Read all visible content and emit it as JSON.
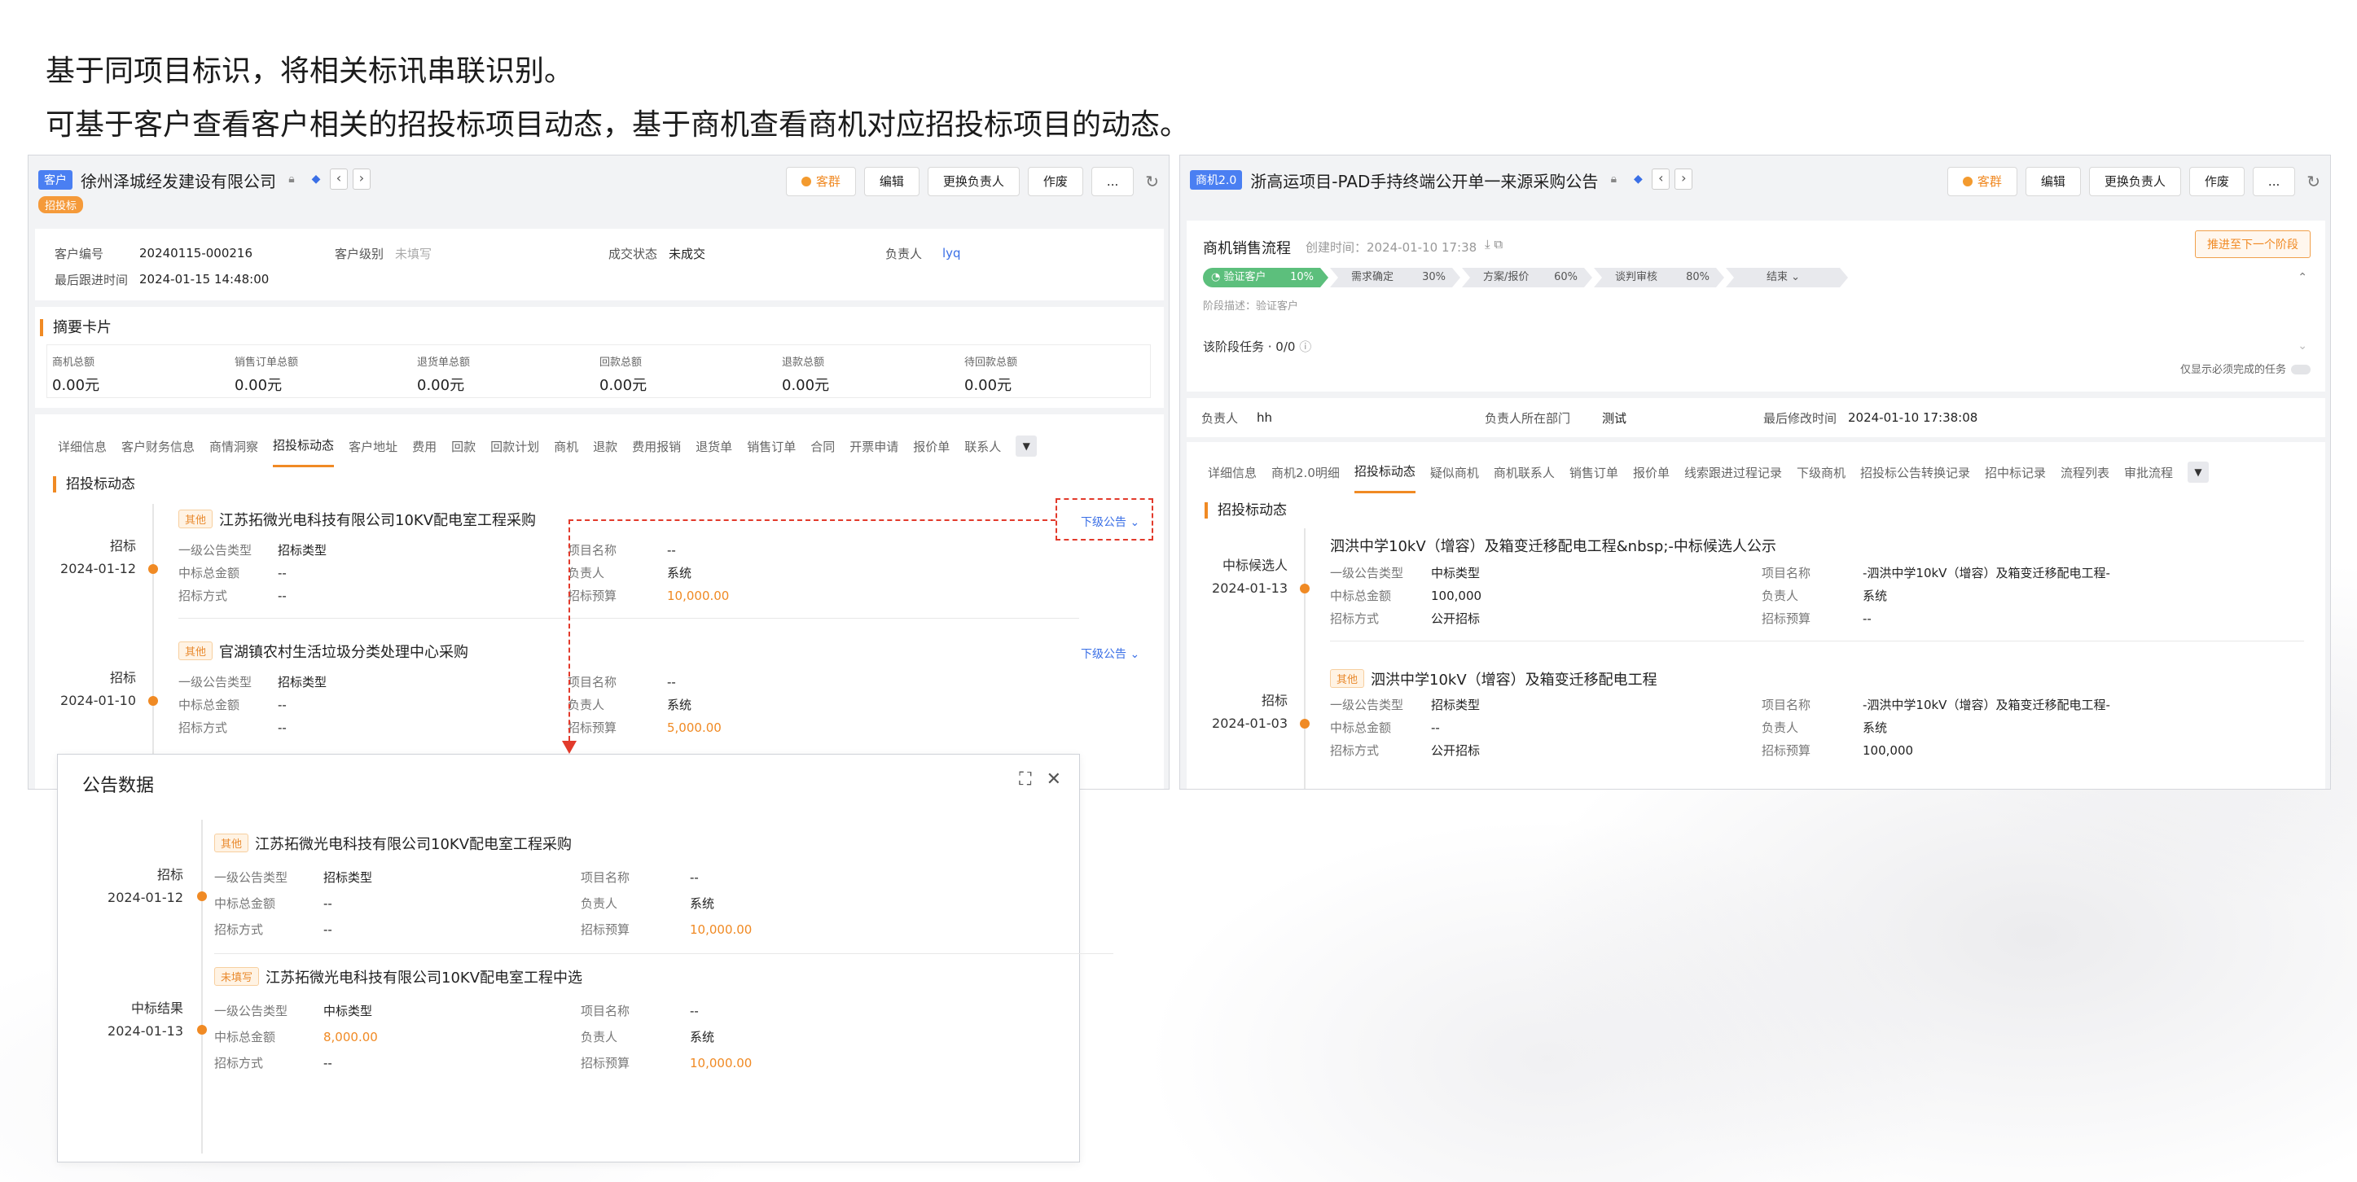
{
  "headline": {
    "line1": "基于同项目标识，将相关标讯串联识别。",
    "line2": "可基于客户查看客户相关的招投标项目动态，基于商机查看商机对应招投标项目的动态。"
  },
  "left": {
    "tag": "客户",
    "title": "徐州泽城经发建设有限公司",
    "sub_tag": "招投标",
    "actions": {
      "group": "客群",
      "edit": "编辑",
      "change_owner": "更换负责人",
      "void": "作废",
      "more": "..."
    },
    "info": {
      "customer_no_label": "客户编号",
      "customer_no": "20240115-000216",
      "level_label": "客户级别",
      "level": "未填写",
      "deal_label": "成交状态",
      "deal": "未成交",
      "owner_label": "负责人",
      "owner": "lyq",
      "last_follow_label": "最后跟进时间",
      "last_follow": "2024-01-15 14:48:00"
    },
    "summary": {
      "title": "摘要卡片",
      "items": [
        {
          "label": "商机总额",
          "value": "0.00元"
        },
        {
          "label": "销售订单总额",
          "value": "0.00元"
        },
        {
          "label": "退货单总额",
          "value": "0.00元"
        },
        {
          "label": "回款总额",
          "value": "0.00元"
        },
        {
          "label": "退款总额",
          "value": "0.00元"
        },
        {
          "label": "待回款总额",
          "value": "0.00元"
        }
      ]
    },
    "tabs": [
      "详细信息",
      "客户财务信息",
      "商情洞察",
      "招投标动态",
      "客户地址",
      "费用",
      "回款",
      "回款计划",
      "商机",
      "退款",
      "费用报销",
      "退货单",
      "销售订单",
      "合同",
      "开票申请",
      "报价单",
      "联系人"
    ],
    "active_tab": "招投标动态",
    "section_title": "招投标动态",
    "records": [
      {
        "type": "招标",
        "date": "2024-01-12",
        "tag": "其他",
        "title": "江苏拓微光电科技有限公司10KV配电室工程采购",
        "sub_link": "下级公告",
        "l1_label": "一级公告类型",
        "l1_value": "招标类型",
        "amount_label": "中标总金额",
        "amount_value": "--",
        "method_label": "招标方式",
        "method_value": "--",
        "name_label": "项目名称",
        "name_value": "--",
        "owner_label": "负责人",
        "owner_value": "系统",
        "budget_label": "招标预算",
        "budget_value": "10,000.00"
      },
      {
        "type": "招标",
        "date": "2024-01-10",
        "tag": "其他",
        "title": "官湖镇农村生活垃圾分类处理中心采购",
        "sub_link": "下级公告",
        "l1_label": "一级公告类型",
        "l1_value": "招标类型",
        "amount_label": "中标总金额",
        "amount_value": "--",
        "method_label": "招标方式",
        "method_value": "--",
        "name_label": "项目名称",
        "name_value": "--",
        "owner_label": "负责人",
        "owner_value": "系统",
        "budget_label": "招标预算",
        "budget_value": "5,000.00"
      }
    ]
  },
  "popup": {
    "title": "公告数据",
    "records": [
      {
        "type": "招标",
        "date": "2024-01-12",
        "tag": "其他",
        "title": "江苏拓微光电科技有限公司10KV配电室工程采购",
        "l1_label": "一级公告类型",
        "l1_value": "招标类型",
        "amount_label": "中标总金额",
        "amount_value": "--",
        "method_label": "招标方式",
        "method_value": "--",
        "name_label": "项目名称",
        "name_value": "--",
        "owner_label": "负责人",
        "owner_value": "系统",
        "budget_label": "招标预算",
        "budget_value": "10,000.00"
      },
      {
        "type": "中标结果",
        "date": "2024-01-13",
        "tag": "未填写",
        "title": "江苏拓微光电科技有限公司10KV配电室工程中选",
        "l1_label": "一级公告类型",
        "l1_value": "中标类型",
        "amount_label": "中标总金额",
        "amount_value": "8,000.00",
        "method_label": "招标方式",
        "method_value": "--",
        "name_label": "项目名称",
        "name_value": "--",
        "owner_label": "负责人",
        "owner_value": "系统",
        "budget_label": "招标预算",
        "budget_value": "10,000.00"
      }
    ]
  },
  "right": {
    "tag": "商机2.0",
    "title": "浙高运项目-PAD手持终端公开单一来源采购公告",
    "actions": {
      "group": "客群",
      "edit": "编辑",
      "change_owner": "更换负责人",
      "void": "作废",
      "more": "..."
    },
    "process": {
      "title": "商机销售流程",
      "created": "创建时间：2024-01-10 17:38",
      "advance_btn": "推进至下一个阶段",
      "stages": [
        {
          "name": "验证客户",
          "pct": "10%"
        },
        {
          "name": "需求确定",
          "pct": "30%"
        },
        {
          "name": "方案/报价",
          "pct": "60%"
        },
        {
          "name": "谈判审核",
          "pct": "80%"
        },
        {
          "name": "结束",
          "pct": ""
        }
      ],
      "stage_desc": "阶段描述：验证客户",
      "task_label": "该阶段任务 · 0/0",
      "only_required": "仅显示必须完成的任务"
    },
    "info": {
      "owner_label": "负责人",
      "owner": "hh",
      "dept_label": "负责人所在部门",
      "dept": "测试",
      "modified_label": "最后修改时间",
      "modified": "2024-01-10 17:38:08"
    },
    "tabs": [
      "详细信息",
      "商机2.0明细",
      "招投标动态",
      "疑似商机",
      "商机联系人",
      "销售订单",
      "报价单",
      "线索跟进过程记录",
      "下级商机",
      "招投标公告转换记录",
      "招中标记录",
      "流程列表",
      "审批流程"
    ],
    "active_tab": "招投标动态",
    "section_title": "招投标动态",
    "records": [
      {
        "type": "中标候选人",
        "date": "2024-01-13",
        "tag": "",
        "title": "泗洪中学10kV（增容）及箱变迁移配电工程&nbsp;-中标候选人公示",
        "l1_label": "一级公告类型",
        "l1_value": "中标类型",
        "amount_label": "中标总金额",
        "amount_value": "100,000",
        "method_label": "招标方式",
        "method_value": "公开招标",
        "name_label": "项目名称",
        "name_value": "-泗洪中学10kV（增容）及箱变迁移配电工程-",
        "owner_label": "负责人",
        "owner_value": "系统",
        "budget_label": "招标预算",
        "budget_value": "--"
      },
      {
        "type": "招标",
        "date": "2024-01-03",
        "tag": "其他",
        "title": "泗洪中学10kV（增容）及箱变迁移配电工程",
        "l1_label": "一级公告类型",
        "l1_value": "招标类型",
        "amount_label": "中标总金额",
        "amount_value": "--",
        "method_label": "招标方式",
        "method_value": "公开招标",
        "name_label": "项目名称",
        "name_value": "-泗洪中学10kV（增容）及箱变迁移配电工程-",
        "owner_label": "负责人",
        "owner_value": "系统",
        "budget_label": "招标预算",
        "budget_value": "100,000"
      }
    ]
  }
}
